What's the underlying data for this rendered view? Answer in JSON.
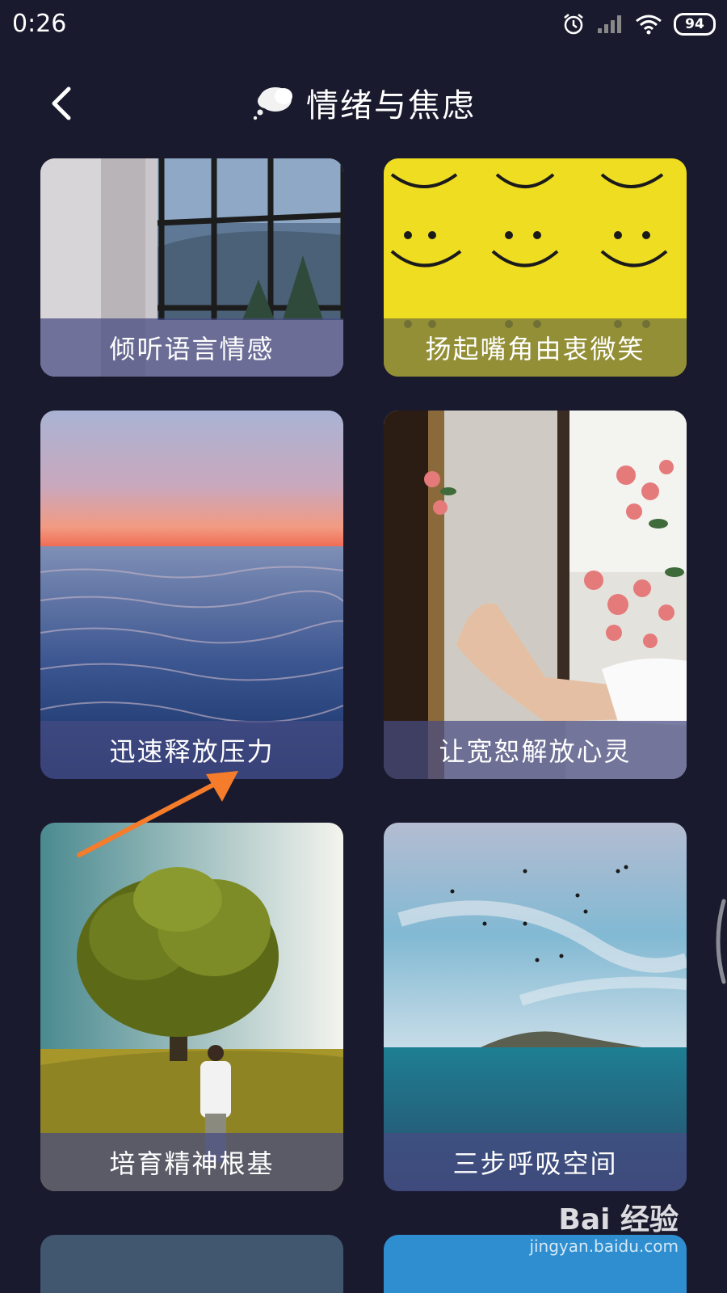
{
  "status_bar": {
    "time": "0:26",
    "battery": "94",
    "icons": [
      "alarm-icon",
      "signal-icon",
      "wifi-icon",
      "battery-icon"
    ]
  },
  "header": {
    "title": "情绪与焦虑",
    "back_icon": "chevron-left-icon",
    "title_icon": "thought-bubble-icon"
  },
  "cards": [
    {
      "label": "倾听语言情感"
    },
    {
      "label": "扬起嘴角由衷微笑"
    },
    {
      "label": "迅速释放压力"
    },
    {
      "label": "让宽恕解放心灵"
    },
    {
      "label": "培育精神根基"
    },
    {
      "label": "三步呼吸空间"
    }
  ],
  "watermark": {
    "brand": "Bai 经验",
    "url": "jingyan.baidu.com"
  },
  "colors": {
    "background": "#1a1a2e",
    "label_overlay": "#464b82",
    "arrow": "#f57c2a"
  }
}
